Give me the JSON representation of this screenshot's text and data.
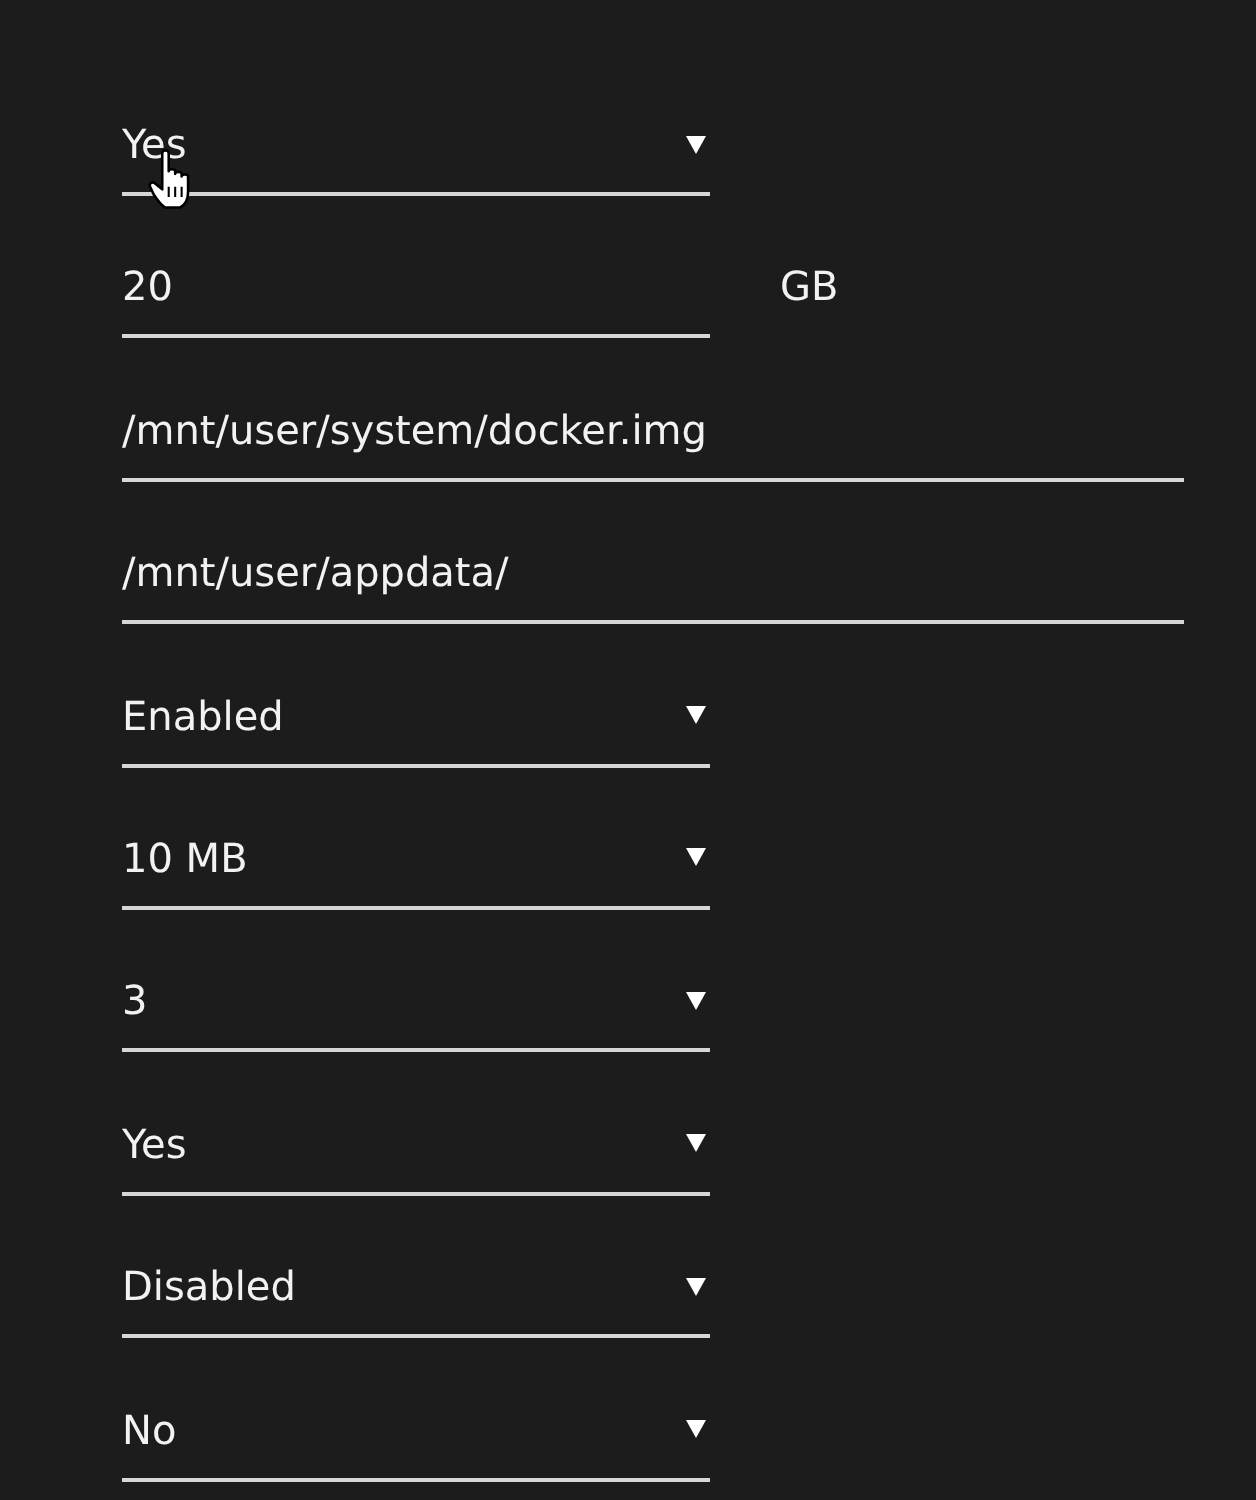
{
  "fields": [
    {
      "kind": "select",
      "value": "Yes",
      "hovered": true
    },
    {
      "kind": "number",
      "value": "20",
      "unit": "GB",
      "hovered": false
    },
    {
      "kind": "path",
      "value": "/mnt/user/system/docker.img",
      "hovered": false
    },
    {
      "kind": "path",
      "value": "/mnt/user/appdata/",
      "hovered": false
    },
    {
      "kind": "select",
      "value": "Enabled",
      "hovered": false
    },
    {
      "kind": "select",
      "value": "10 MB",
      "hovered": false
    },
    {
      "kind": "select",
      "value": "3",
      "hovered": false
    },
    {
      "kind": "select",
      "value": "Yes",
      "hovered": false
    },
    {
      "kind": "select",
      "value": "Disabled",
      "hovered": false
    },
    {
      "kind": "select",
      "value": "No",
      "hovered": false
    }
  ]
}
